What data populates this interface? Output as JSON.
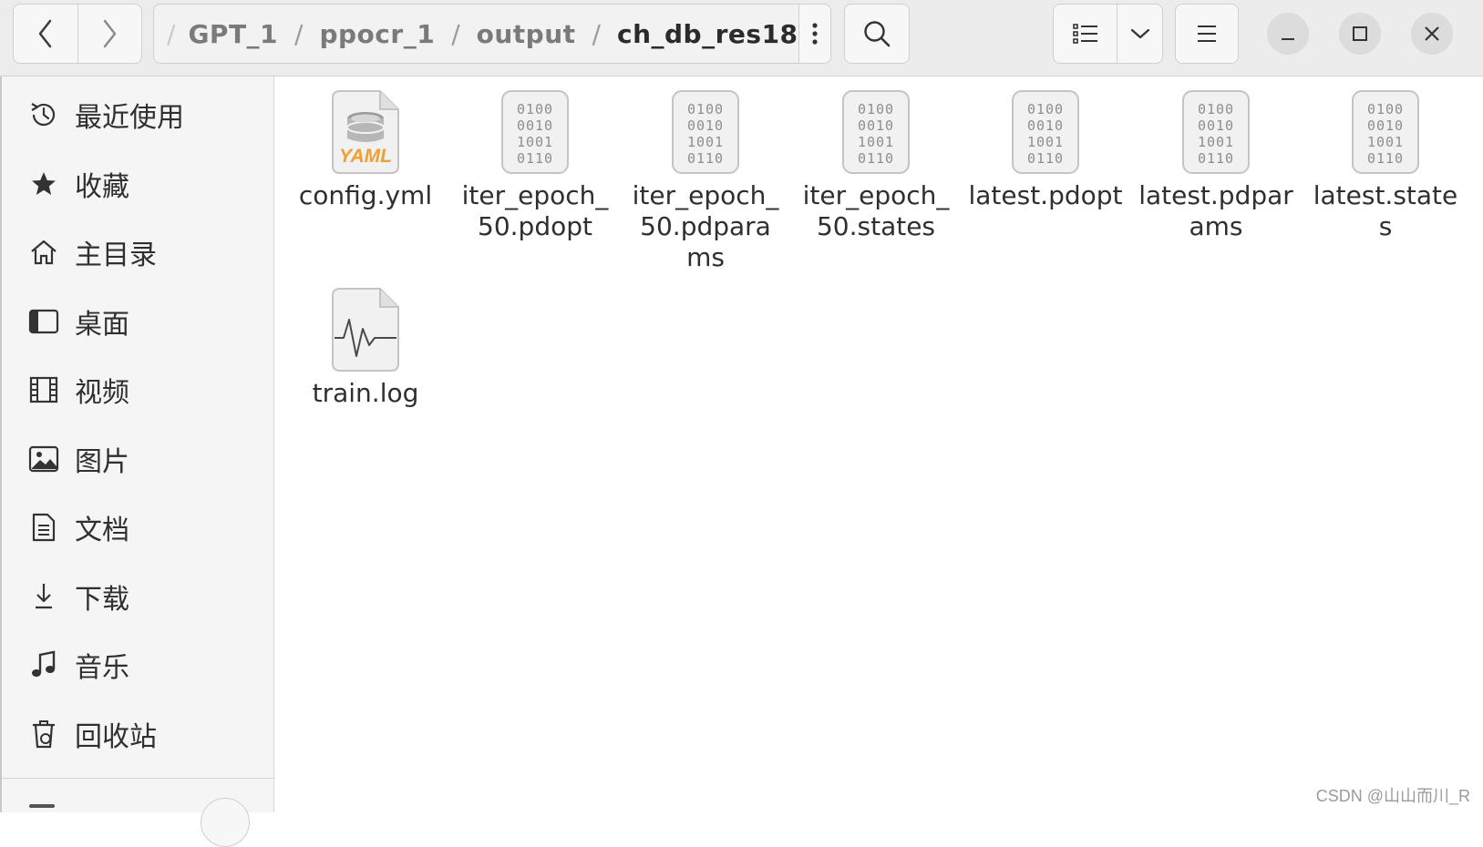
{
  "header": {
    "breadcrumbs": [
      "GPT_1",
      "ppocr_1",
      "output",
      "ch_db_res18"
    ],
    "separator": "/"
  },
  "sidebar": {
    "items": [
      {
        "label": "最近使用",
        "icon": "clock-history-icon"
      },
      {
        "label": "收藏",
        "icon": "star-icon"
      },
      {
        "label": "主目录",
        "icon": "home-icon"
      },
      {
        "label": "桌面",
        "icon": "desktop-icon"
      },
      {
        "label": "视频",
        "icon": "film-icon"
      },
      {
        "label": "图片",
        "icon": "image-icon"
      },
      {
        "label": "文档",
        "icon": "document-icon"
      },
      {
        "label": "下载",
        "icon": "download-icon"
      },
      {
        "label": "音乐",
        "icon": "music-icon"
      },
      {
        "label": "回收站",
        "icon": "trash-icon"
      }
    ]
  },
  "files": [
    {
      "name": "config.yml",
      "icon": "yaml-file-icon",
      "badge": "YAML"
    },
    {
      "name": "iter_epoch_50.pdopt",
      "icon": "binary-file-icon"
    },
    {
      "name": "iter_epoch_50.pdparams",
      "icon": "binary-file-icon"
    },
    {
      "name": "iter_epoch_50.states",
      "icon": "binary-file-icon"
    },
    {
      "name": "latest.pdopt",
      "icon": "binary-file-icon"
    },
    {
      "name": "latest.pdparams",
      "icon": "binary-file-icon"
    },
    {
      "name": "latest.states",
      "icon": "binary-file-icon"
    },
    {
      "name": "train.log",
      "icon": "log-file-icon"
    }
  ],
  "binary_icon_text": [
    "0100",
    "0010",
    "1001",
    "0110"
  ],
  "watermark": "CSDN @山山而川_R",
  "colors": {
    "header_bg": "#ececec",
    "sidebar_bg": "#f5f5f5",
    "yaml_accent": "#f0a030"
  }
}
